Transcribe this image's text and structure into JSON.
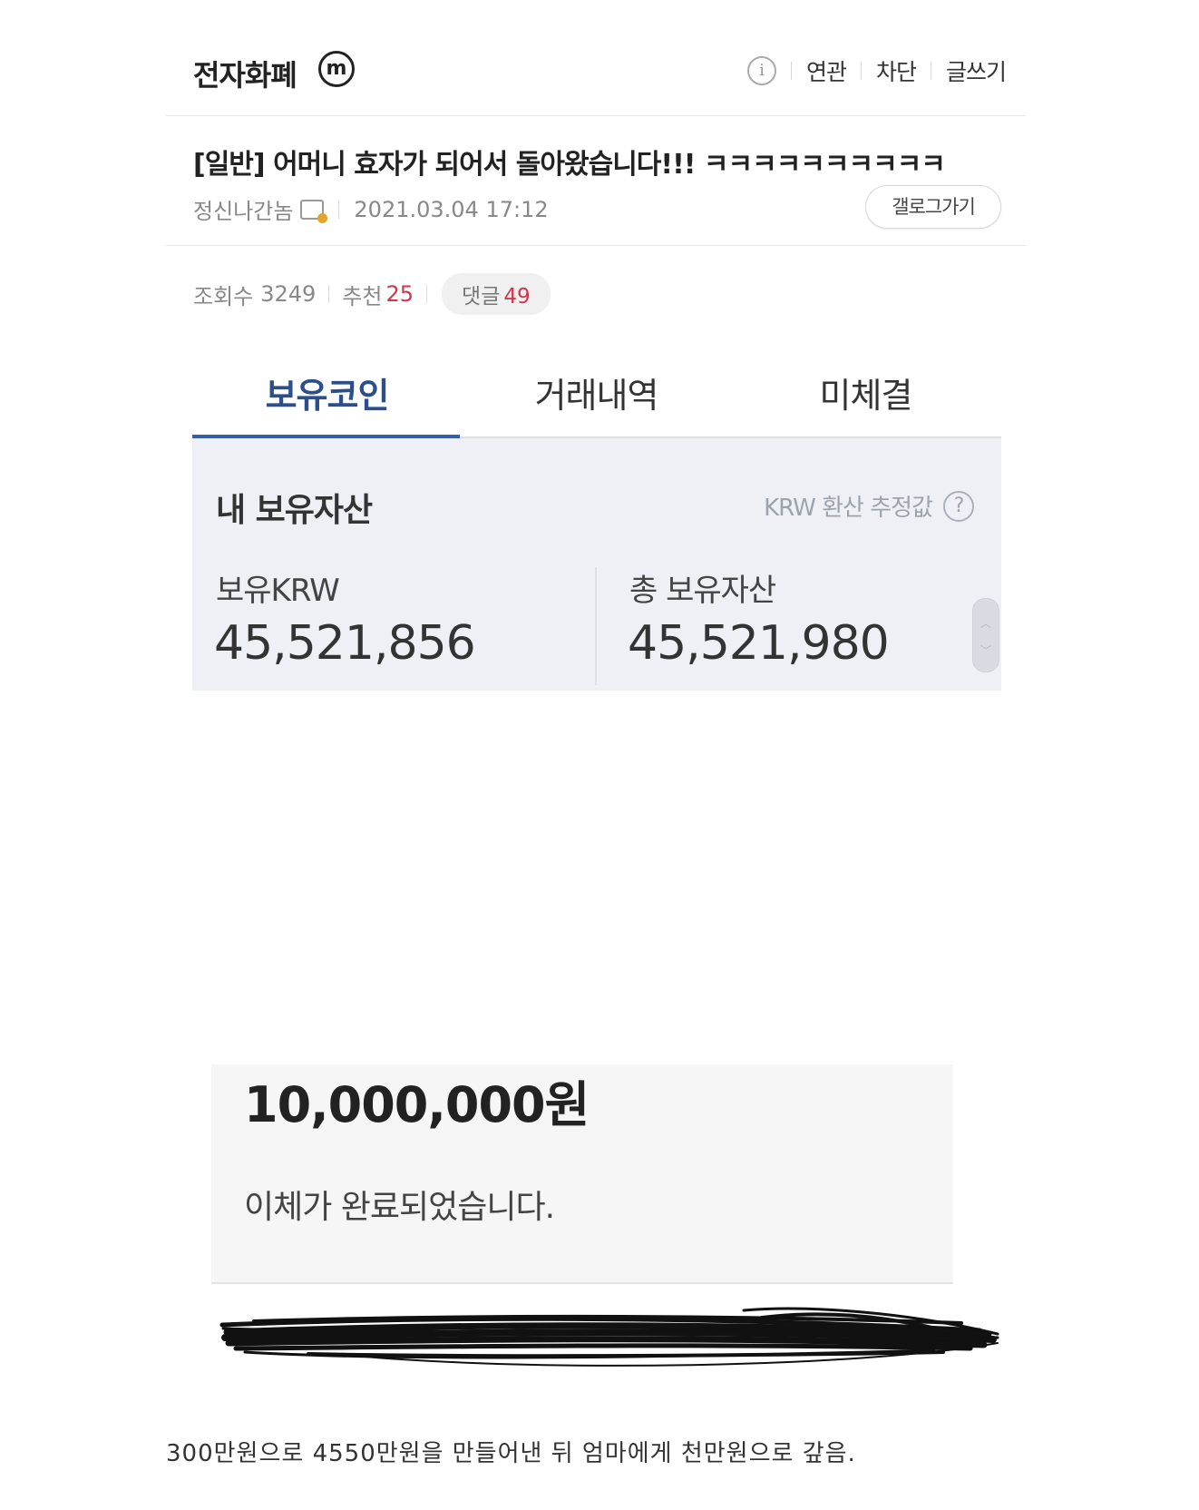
{
  "gallery": {
    "name": "전자화폐",
    "minor_badge": "m",
    "actions": [
      "연관",
      "차단",
      "글쓰기"
    ]
  },
  "post": {
    "title": "[일반] 어머니 효자가 되어서 돌아왔습니다!!! ㅋㅋㅋㅋㅋㅋㅋㅋㅋㅋ",
    "author": "정신나간놈",
    "datetime": "2021.03.04 17:12",
    "gallery_button": "갤로그가기",
    "views_label": "조회수",
    "views": "3249",
    "recommend_label": "추천",
    "recommend": "25",
    "comments_label": "댓글",
    "comments": "49"
  },
  "exchange": {
    "tabs": [
      "보유코인",
      "거래내역",
      "미체결"
    ],
    "active_tab": 0,
    "panel_title": "내 보유자산",
    "krw_note": "KRW 환산 추정값",
    "held_krw_label": "보유KRW",
    "held_krw_value": "45,521,856",
    "total_label": "총 보유자산",
    "total_value": "45,521,980"
  },
  "transfer": {
    "amount": "10,000,000원",
    "message": "이체가 완료되었습니다."
  },
  "caption": "300만원으로 4550만원을 만들어낸 뒤 엄마에게 천만원으로 갚음.",
  "colors": {
    "accent_blue": "#3560a8",
    "red_count": "#d2344a",
    "panel_bg": "#eef0f6"
  }
}
